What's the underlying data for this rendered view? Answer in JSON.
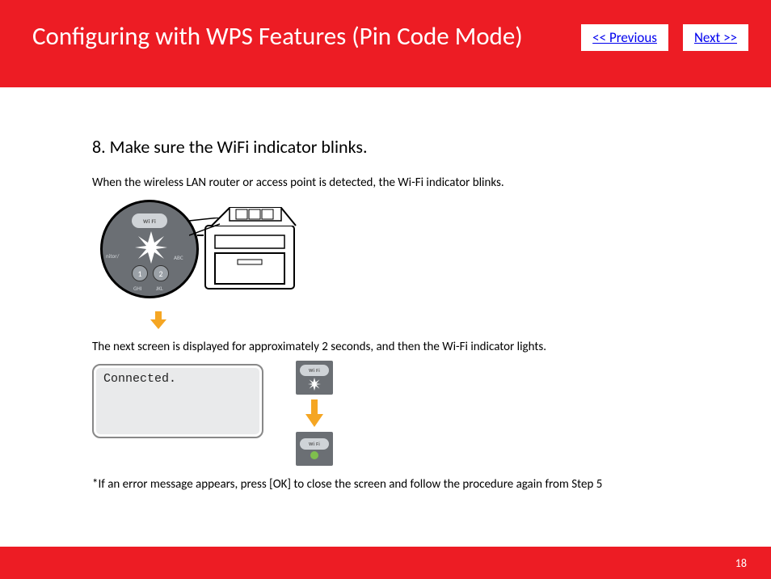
{
  "header": {
    "title": "Configuring with WPS Features (Pin Code Mode)",
    "prev_label": "<< Previous",
    "next_label": "Next >>"
  },
  "content": {
    "step_heading": "8. Make sure the WiFi indicator blinks.",
    "para1": "When the wireless LAN router or access point is detected, the Wi-Fi indicator blinks.",
    "para2": "The next screen is displayed for approximately 2 seconds, and then the Wi-Fi indicator lights.",
    "lcd_text": "Connected.",
    "note": "*If an error message appears, press [OK] to close the screen and follow the procedure again from Step 5",
    "wifi_label": "Wi Fi"
  },
  "keypad": {
    "b1": "1",
    "b2": "2",
    "t_left": "nitor/",
    "t_right": "ABC",
    "t_bl": "GHI",
    "t_br": "JKL"
  },
  "footer": {
    "page": "18"
  },
  "colors": {
    "accent": "#ed1c24",
    "arrow": "#f5a623",
    "link": "#0000ee"
  }
}
